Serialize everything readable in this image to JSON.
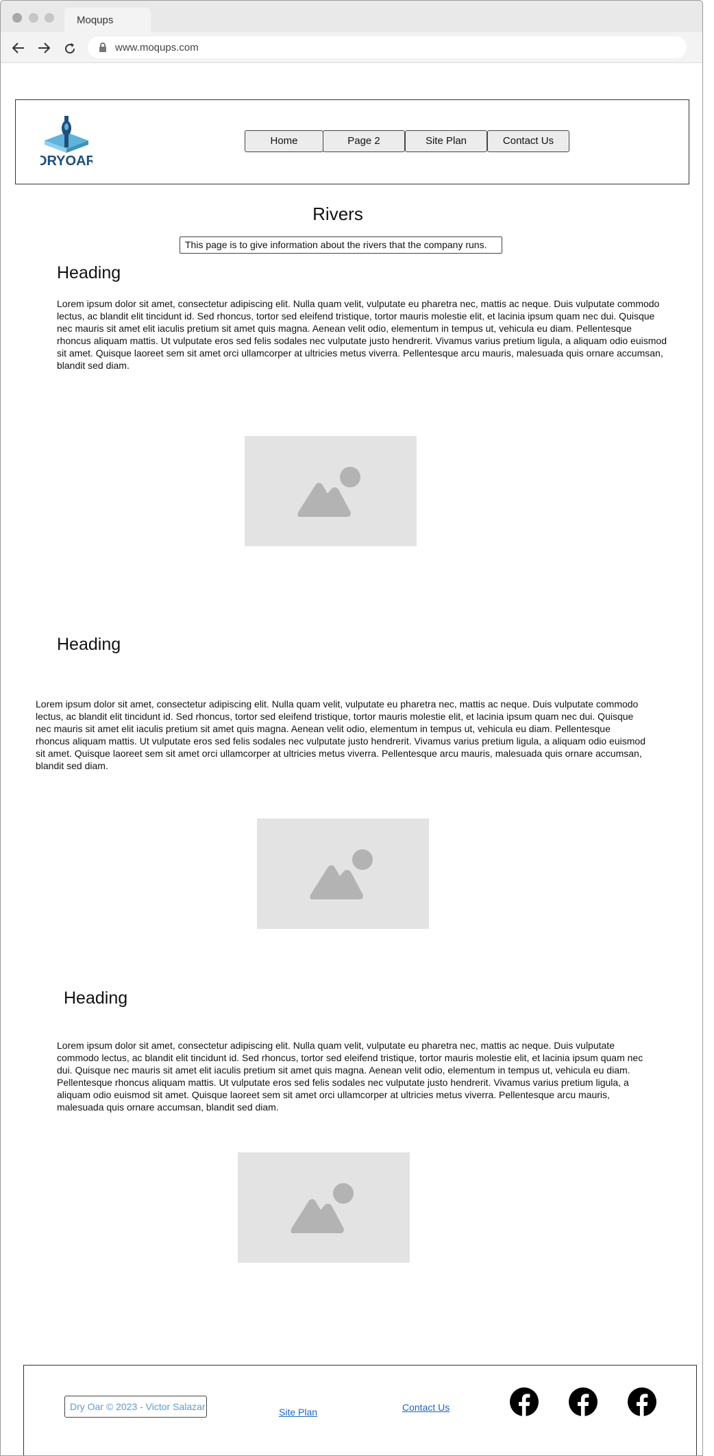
{
  "browser": {
    "tab_title": "Moqups",
    "url": "www.moqups.com"
  },
  "header": {
    "logo_text": "DRYOAR",
    "nav": [
      "Home",
      "Page 2",
      "Site Plan",
      "Contact Us"
    ]
  },
  "page": {
    "title": "Rivers",
    "intro": "This page is to give information about the rivers that the company runs."
  },
  "sections": [
    {
      "heading": "Heading",
      "text": "Lorem ipsum dolor sit amet, consectetur adipiscing elit. Nulla quam velit, vulputate eu pharetra nec, mattis ac neque. Duis vulputate commodo lectus, ac blandit elit tincidunt id. Sed rhoncus, tortor sed eleifend tristique, tortor mauris molestie elit, et lacinia ipsum quam nec dui. Quisque nec mauris sit amet elit iaculis pretium sit amet quis magna. Aenean velit odio, elementum in tempus ut, vehicula eu diam. Pellentesque rhoncus aliquam mattis. Ut vulputate eros sed felis sodales nec vulputate justo hendrerit. Vivamus varius pretium ligula, a aliquam odio euismod sit amet. Quisque laoreet sem sit amet orci ullamcorper at ultricies metus viverra. Pellentesque arcu mauris, malesuada quis ornare accumsan, blandit sed diam."
    },
    {
      "heading": "Heading",
      "text": "Lorem ipsum dolor sit amet, consectetur adipiscing elit. Nulla quam velit, vulputate eu pharetra nec, mattis ac neque. Duis vulputate commodo lectus, ac blandit elit tincidunt id. Sed rhoncus, tortor sed eleifend tristique, tortor mauris molestie elit, et lacinia ipsum quam nec dui. Quisque nec mauris sit amet elit iaculis pretium sit amet quis magna. Aenean velit odio, elementum in tempus ut, vehicula eu diam. Pellentesque rhoncus aliquam mattis. Ut vulputate eros sed felis sodales nec vulputate justo hendrerit. Vivamus varius pretium ligula, a aliquam odio euismod sit amet. Quisque laoreet sem sit amet orci ullamcorper at ultricies metus viverra. Pellentesque arcu mauris, malesuada quis ornare accumsan, blandit sed diam."
    },
    {
      "heading": "Heading",
      "text": "Lorem ipsum dolor sit amet, consectetur adipiscing elit. Nulla quam velit, vulputate eu pharetra nec, mattis ac neque. Duis vulputate commodo lectus, ac blandit elit tincidunt id. Sed rhoncus, tortor sed eleifend tristique, tortor mauris molestie elit, et lacinia ipsum quam nec dui. Quisque nec mauris sit amet elit iaculis pretium sit amet quis magna. Aenean velit odio, elementum in tempus ut, vehicula eu diam. Pellentesque rhoncus aliquam mattis. Ut vulputate eros sed felis sodales nec vulputate justo hendrerit. Vivamus varius pretium ligula, a aliquam odio euismod sit amet. Quisque laoreet sem sit amet orci ullamcorper at ultricies metus viverra. Pellentesque arcu mauris, malesuada quis ornare accumsan, blandit sed diam."
    }
  ],
  "footer": {
    "copyright": "Dry Oar © 2023 - Victor Salazar",
    "site_plan_link": "Site Plan",
    "contact_link": "Contact Us",
    "social_icons": [
      "facebook-icon",
      "facebook-icon",
      "facebook-icon"
    ]
  },
  "colors": {
    "link": "#1a63c9",
    "copyright_text": "#5a9bd5",
    "placeholder_bg": "#e3e3e3",
    "placeholder_glyph": "#b3b3b3",
    "logo_blue": "#1f4f7a",
    "logo_light_blue": "#5fb3d9"
  }
}
